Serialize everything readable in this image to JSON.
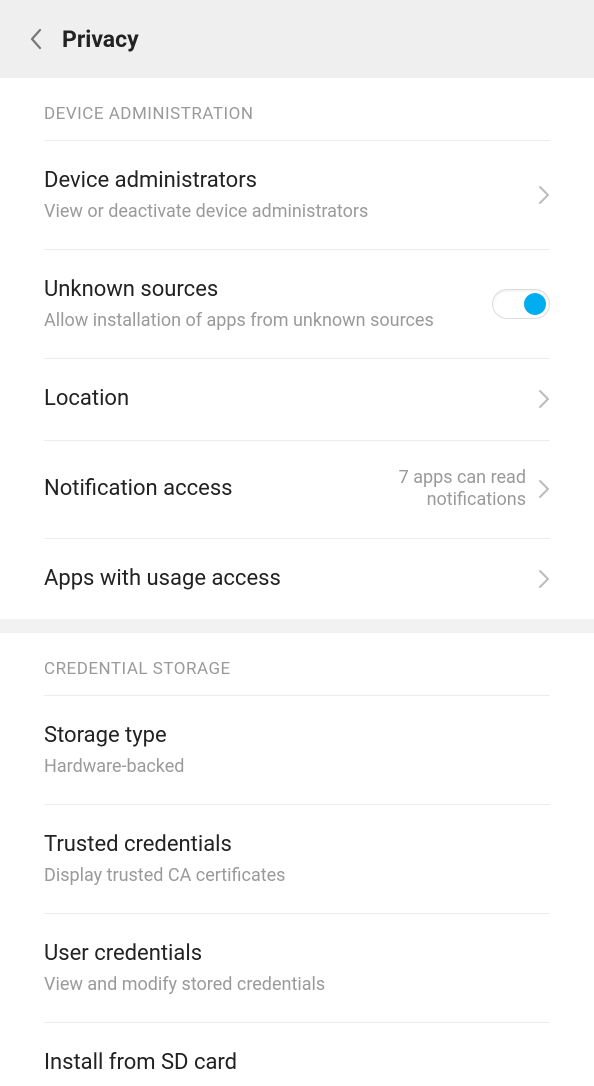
{
  "header": {
    "title": "Privacy"
  },
  "sections": {
    "device_admin": {
      "label": "DEVICE ADMINISTRATION",
      "device_admins": {
        "title": "Device administrators",
        "sub": "View or deactivate device administrators"
      },
      "unknown_sources": {
        "title": "Unknown sources",
        "sub": "Allow installation of apps from unknown sources",
        "enabled": true
      },
      "location": {
        "title": "Location"
      },
      "notification_access": {
        "title": "Notification access",
        "status": "7 apps can read notifications"
      },
      "apps_usage": {
        "title": "Apps with usage access"
      }
    },
    "credential_storage": {
      "label": "CREDENTIAL STORAGE",
      "storage_type": {
        "title": "Storage type",
        "sub": "Hardware-backed"
      },
      "trusted": {
        "title": "Trusted credentials",
        "sub": "Display trusted CA certificates"
      },
      "user": {
        "title": "User credentials",
        "sub": "View and modify stored credentials"
      },
      "install_sd": {
        "title": "Install from SD card"
      }
    }
  }
}
